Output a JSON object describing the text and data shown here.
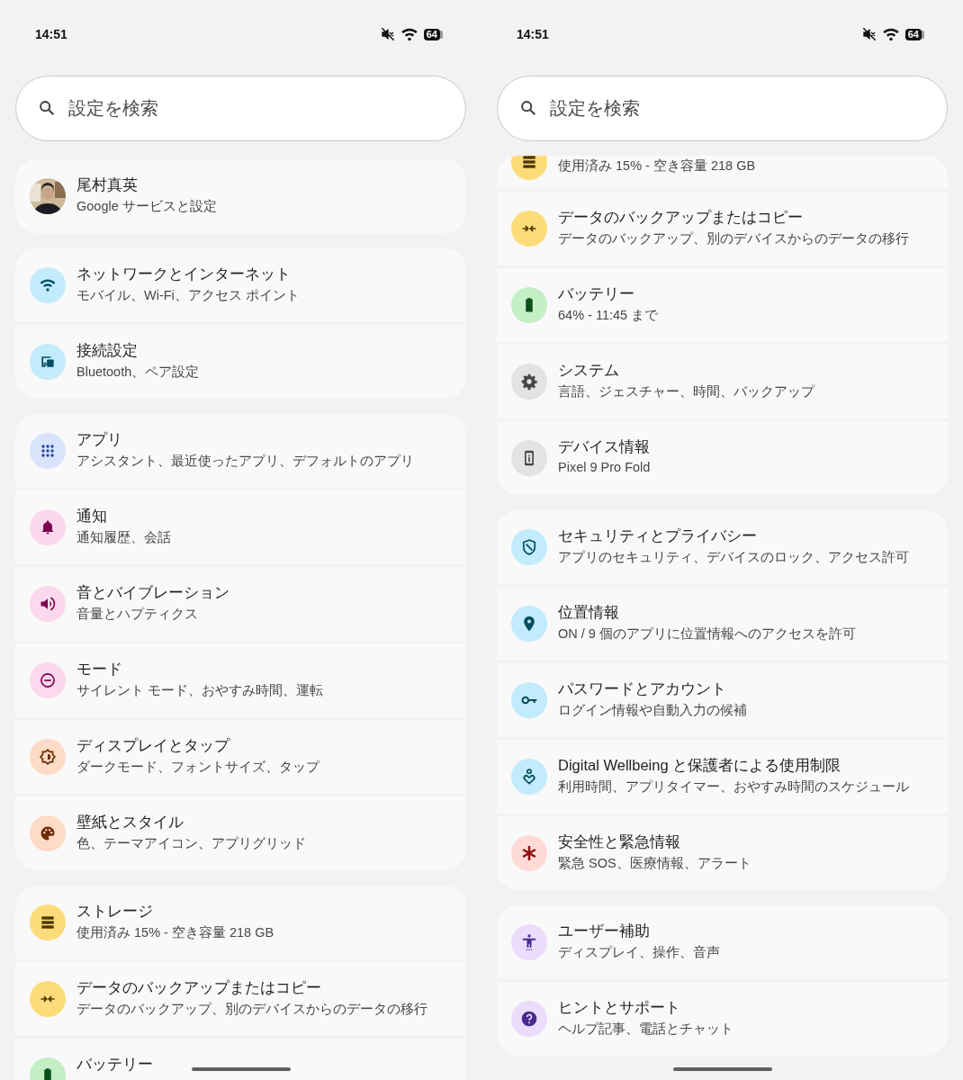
{
  "screens": [
    {
      "status_bar": {
        "time": "14:51",
        "battery": "64"
      },
      "search": {
        "placeholder": "設定を検索"
      },
      "groups": [
        {
          "items": [
            {
              "kind": "profile",
              "title": "尾村真英",
              "subtitle": "Google サービスと設定"
            }
          ]
        },
        {
          "items": [
            {
              "kind": "wifi",
              "color": "#c2ebfc",
              "title": "ネットワークとインターネット",
              "subtitle": "モバイル、Wi-Fi、アクセス ポイント"
            },
            {
              "kind": "devices",
              "color": "#c2ebfc",
              "title": "接続設定",
              "subtitle": "Bluetooth、ペア設定"
            }
          ]
        },
        {
          "items": [
            {
              "kind": "apps",
              "color": "#d9e3fb",
              "title": "アプリ",
              "subtitle": "アシスタント、最近使ったアプリ、デフォルトのアプリ"
            },
            {
              "kind": "bell",
              "color": "#fcd8ee",
              "title": "通知",
              "subtitle": "通知履歴、会話"
            },
            {
              "kind": "sound",
              "color": "#fcd8ee",
              "title": "音とバイブレーション",
              "subtitle": "音量とハプティクス"
            },
            {
              "kind": "mode",
              "color": "#fcd8ee",
              "title": "モード",
              "subtitle": "サイレント モード、おやすみ時間、運転"
            },
            {
              "kind": "display",
              "color": "#fddbc6",
              "title": "ディスプレイとタップ",
              "subtitle": "ダークモード、フォントサイズ、タップ"
            },
            {
              "kind": "palette",
              "color": "#fddbc6",
              "title": "壁紙とスタイル",
              "subtitle": "色、テーマアイコン、アプリグリッド"
            }
          ]
        },
        {
          "items": [
            {
              "kind": "storage",
              "color": "#fcdc79",
              "title": "ストレージ",
              "subtitle": "使用済み 15% - 空き容量 218 GB"
            },
            {
              "kind": "backup",
              "color": "#fcdc79",
              "title": "データのバックアップまたはコピー",
              "subtitle": "データのバックアップ、別のデバイスからのデータの移行"
            },
            {
              "kind": "battery",
              "color": "#c4eec4",
              "title": "バッテリー"
            }
          ]
        }
      ]
    },
    {
      "status_bar": {
        "time": "14:51",
        "battery": "64"
      },
      "search": {
        "placeholder": "設定を検索"
      },
      "groups": [
        {
          "items": [
            {
              "kind": "storage",
              "color": "#fcdc79",
              "subtitle": "使用済み 15% - 空き容量 218 GB"
            },
            {
              "kind": "backup",
              "color": "#fcdc79",
              "title": "データのバックアップまたはコピー",
              "subtitle": "データのバックアップ、別のデバイスからのデータの移行"
            },
            {
              "kind": "battery",
              "color": "#c4eec4",
              "title": "バッテリー",
              "subtitle": "64% - 11:45 まで"
            },
            {
              "kind": "gear",
              "color": "#e3e3e3",
              "title": "システム",
              "subtitle": "言語、ジェスチャー、時間、バックアップ"
            },
            {
              "kind": "phone",
              "color": "#e3e3e3",
              "title": "デバイス情報",
              "subtitle": "Pixel 9 Pro Fold"
            }
          ]
        },
        {
          "items": [
            {
              "kind": "shield",
              "color": "#c2ebfc",
              "title": "セキュリティとプライバシー",
              "subtitle": "アプリのセキュリティ、デバイスのロック、アクセス許可"
            },
            {
              "kind": "pin",
              "color": "#c2ebfc",
              "title": "位置情報",
              "subtitle": "ON / 9 個のアプリに位置情報へのアクセスを許可"
            },
            {
              "kind": "key",
              "color": "#c2ebfc",
              "title": "パスワードとアカウント",
              "subtitle": "ログイン情報や自動入力の候補"
            },
            {
              "kind": "wellbeing",
              "color": "#c2ebfc",
              "title": "Digital Wellbeing と保護者による使用制限",
              "subtitle": "利用時間、アプリタイマー、おやすみ時間のスケジュール"
            },
            {
              "kind": "asterisk",
              "color": "#ffdad7",
              "title": "安全性と緊急情報",
              "subtitle": "緊急 SOS、医療情報、アラート"
            }
          ]
        },
        {
          "items": [
            {
              "kind": "accessibility",
              "color": "#ebdcfc",
              "title": "ユーザー補助",
              "subtitle": "ディスプレイ、操作、音声"
            },
            {
              "kind": "help",
              "color": "#ebdcfc",
              "title": "ヒントとサポート",
              "subtitle": "ヘルプ記事、電話とチャット"
            }
          ]
        }
      ]
    }
  ]
}
